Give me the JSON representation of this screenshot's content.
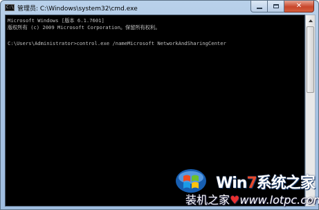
{
  "window": {
    "title": "管理员: C:\\Windows\\system32\\cmd.exe",
    "icon": "cmd-icon",
    "icon_glyph": "C:\\",
    "controls": {
      "minimize": "minimize-icon",
      "maximize": "maximize-icon",
      "close_label": "✕"
    }
  },
  "console": {
    "background": "#000000",
    "text_color": "#c0c0c0",
    "lines": [
      "Microsoft Windows [版本 6.1.7601]",
      "版权所有 (c) 2009 Microsoft Corporation。保留所有权利。",
      "",
      "C:\\Users\\Administrator>control.exe /nameMicrosoft NetworkAndSharingCenter"
    ]
  },
  "watermark": {
    "brand_prefix": "Win",
    "brand_seven": "7",
    "brand_suffix": "系统之家",
    "site_prefix": "装机之家",
    "site_heart": "♥",
    "site_url": "www.lotpc.com"
  },
  "colors": {
    "titlebar": "#a9c4e3",
    "close_button": "#c8462a"
  }
}
